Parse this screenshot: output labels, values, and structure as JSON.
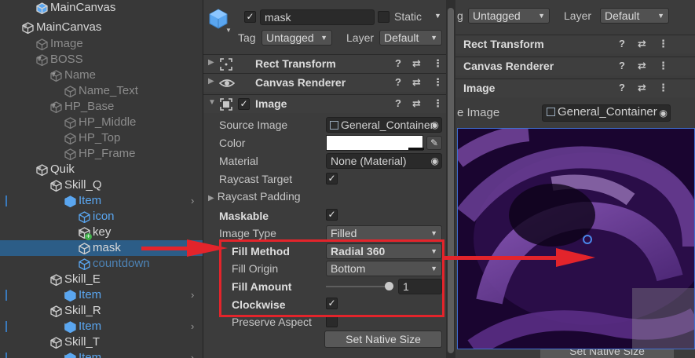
{
  "hierarchy": {
    "items": [
      {
        "label": "MainCanvas",
        "color": "white",
        "arrow": "",
        "indent": 64,
        "prefab": true,
        "top": 0
      },
      {
        "label": "MainCanvas",
        "color": "white",
        "arrow": "▼",
        "indent": 46,
        "prefab": false
      },
      {
        "label": "Image",
        "color": "grey",
        "arrow": "",
        "indent": 64,
        "prefab": false
      },
      {
        "label": "BOSS",
        "color": "grey",
        "arrow": "▼",
        "indent": 64,
        "prefab": false
      },
      {
        "label": "Name",
        "color": "grey",
        "arrow": "▼",
        "indent": 82,
        "prefab": false
      },
      {
        "label": "Name_Text",
        "color": "grey",
        "arrow": "",
        "indent": 100,
        "prefab": false
      },
      {
        "label": "HP_Base",
        "color": "grey",
        "arrow": "▼",
        "indent": 82,
        "prefab": false
      },
      {
        "label": "HP_Middle",
        "color": "grey",
        "arrow": "",
        "indent": 100,
        "prefab": false
      },
      {
        "label": "HP_Top",
        "color": "grey",
        "arrow": "",
        "indent": 100,
        "prefab": false
      },
      {
        "label": "HP_Frame",
        "color": "grey",
        "arrow": "",
        "indent": 100,
        "prefab": false
      },
      {
        "label": "Quik",
        "color": "white",
        "arrow": "▼",
        "indent": 64,
        "prefab": false
      },
      {
        "label": "Skill_Q",
        "color": "white",
        "arrow": "▼",
        "indent": 82,
        "prefab": false
      },
      {
        "label": "Item",
        "color": "blue",
        "arrow": "▼",
        "indent": 100,
        "prefab": true,
        "mark": true,
        "chev": true
      },
      {
        "label": "icon",
        "color": "blue",
        "arrow": "",
        "indent": 118,
        "prefab": false
      },
      {
        "label": "key",
        "color": "white",
        "arrow": "▶",
        "indent": 118,
        "prefab": false,
        "plus": true
      },
      {
        "label": "mask",
        "color": "white",
        "arrow": "",
        "indent": 118,
        "prefab": false,
        "selected": true
      },
      {
        "label": "countdown",
        "color": "bluedim",
        "arrow": "",
        "indent": 118,
        "prefab": false
      },
      {
        "label": "Skill_E",
        "color": "white",
        "arrow": "▼",
        "indent": 82,
        "prefab": false
      },
      {
        "label": "Item",
        "color": "blue",
        "arrow": "▶",
        "indent": 100,
        "prefab": true,
        "mark": true,
        "chev": true
      },
      {
        "label": "Skill_R",
        "color": "white",
        "arrow": "▼",
        "indent": 82,
        "prefab": false
      },
      {
        "label": "Item",
        "color": "blue",
        "arrow": "▶",
        "indent": 100,
        "prefab": true,
        "mark": true,
        "chev": true
      },
      {
        "label": "Skill_T",
        "color": "white",
        "arrow": "▼",
        "indent": 82,
        "prefab": false
      },
      {
        "label": "Item",
        "color": "blue",
        "arrow": "▶",
        "indent": 100,
        "prefab": true,
        "mark": true,
        "chev": true
      }
    ]
  },
  "inspector": {
    "object_name": "mask",
    "active": true,
    "static_label": "Static",
    "tag_label": "Tag",
    "tag_value": "Untagged",
    "layer_label": "Layer",
    "layer_value": "Default",
    "components": {
      "rect_transform": "Rect Transform",
      "canvas_renderer": "Canvas Renderer",
      "image": "Image"
    },
    "header_icons": {
      "help": "?",
      "preset": "⇄",
      "menu": "⋮"
    },
    "image": {
      "source_image_label": "Source Image",
      "source_image_value": "General_Container",
      "color_label": "Color",
      "material_label": "Material",
      "material_value": "None (Material)",
      "raycast_target_label": "Raycast Target",
      "raycast_target": true,
      "raycast_padding_label": "Raycast Padding",
      "maskable_label": "Maskable",
      "maskable": true,
      "image_type_label": "Image Type",
      "image_type_value": "Filled",
      "fill_method_label": "Fill Method",
      "fill_method_value": "Radial 360",
      "fill_origin_label": "Fill Origin",
      "fill_origin_value": "Bottom",
      "fill_amount_label": "Fill Amount",
      "fill_amount_value": "1",
      "fill_amount_fraction": 1.0,
      "clockwise_label": "Clockwise",
      "clockwise": true,
      "preserve_aspect_label": "Preserve Aspect",
      "preserve_aspect": false,
      "set_native_size_label": "Set Native Size"
    }
  },
  "right_panel": {
    "tag_label_partial": "g",
    "tag_value": "Untagged",
    "layer_label": "Layer",
    "layer_value": "Default",
    "rect_transform": "Rect Transform",
    "canvas_renderer": "Canvas Renderer",
    "image": "Image",
    "source_image_label_partial": "e Image",
    "source_image_value": "General_Container",
    "set_native_size_label": "Set Native Size"
  },
  "colors": {
    "annotation_red": "#e3242b",
    "selection_blue": "#2c5d87",
    "prefab_blue": "#5aa6f0"
  }
}
